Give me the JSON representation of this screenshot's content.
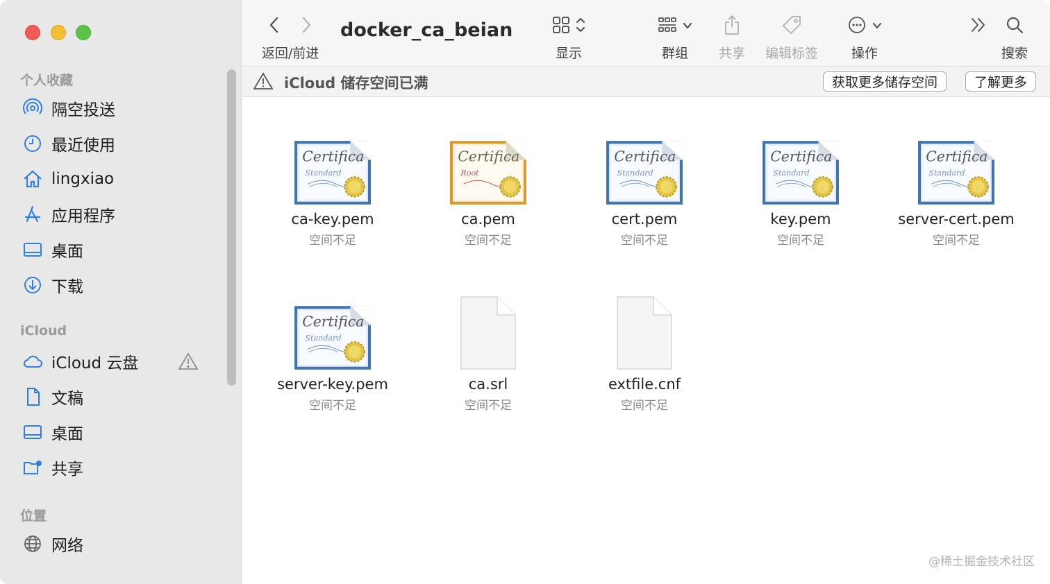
{
  "window": {
    "folder_title": "docker_ca_beian"
  },
  "toolbar": {
    "nav_label": "返回/前进",
    "view_label": "显示",
    "group_label": "群组",
    "share_label": "共享",
    "tags_label": "编辑标签",
    "action_label": "操作",
    "search_label": "搜索"
  },
  "banner": {
    "text": "iCloud 储存空间已满",
    "get_more_label": "获取更多储存空间",
    "learn_more_label": "了解更多"
  },
  "sidebar": {
    "favorites_header": "个人收藏",
    "favorites": [
      {
        "label": "隔空投送",
        "icon": "airdrop-icon"
      },
      {
        "label": "最近使用",
        "icon": "clock-icon"
      },
      {
        "label": "lingxiao",
        "icon": "home-icon"
      },
      {
        "label": "应用程序",
        "icon": "applications-icon"
      },
      {
        "label": "桌面",
        "icon": "desktop-icon"
      },
      {
        "label": "下载",
        "icon": "download-icon"
      }
    ],
    "icloud_header": "iCloud",
    "icloud": [
      {
        "label": "iCloud 云盘",
        "icon": "cloud-icon"
      },
      {
        "label": "文稿",
        "icon": "document-icon"
      },
      {
        "label": "桌面",
        "icon": "desktop-icon"
      },
      {
        "label": "共享",
        "icon": "shared-folder-icon"
      }
    ],
    "locations_header": "位置",
    "locations": [
      {
        "label": "网络",
        "icon": "globe-icon"
      }
    ]
  },
  "files": [
    {
      "name": "ca-key.pem",
      "status": "空间不足",
      "kind": "certificate-standard"
    },
    {
      "name": "ca.pem",
      "status": "空间不足",
      "kind": "certificate-root"
    },
    {
      "name": "cert.pem",
      "status": "空间不足",
      "kind": "certificate-standard"
    },
    {
      "name": "key.pem",
      "status": "空间不足",
      "kind": "certificate-standard"
    },
    {
      "name": "server-cert.pem",
      "status": "空间不足",
      "kind": "certificate-standard"
    },
    {
      "name": "server-key.pem",
      "status": "空间不足",
      "kind": "certificate-standard"
    },
    {
      "name": "ca.srl",
      "status": "空间不足",
      "kind": "blank-document"
    },
    {
      "name": "extfile.cnf",
      "status": "空间不足",
      "kind": "blank-document"
    }
  ],
  "certificate_text": {
    "word": "Certificate",
    "standard": "Standard",
    "root": "Root"
  },
  "watermark": "@稀土掘金技术社区",
  "colors": {
    "accent_blue": "#2f7fe0",
    "cert_blue_frame": "#3c6fa8",
    "cert_gold_frame": "#d89a2a"
  }
}
